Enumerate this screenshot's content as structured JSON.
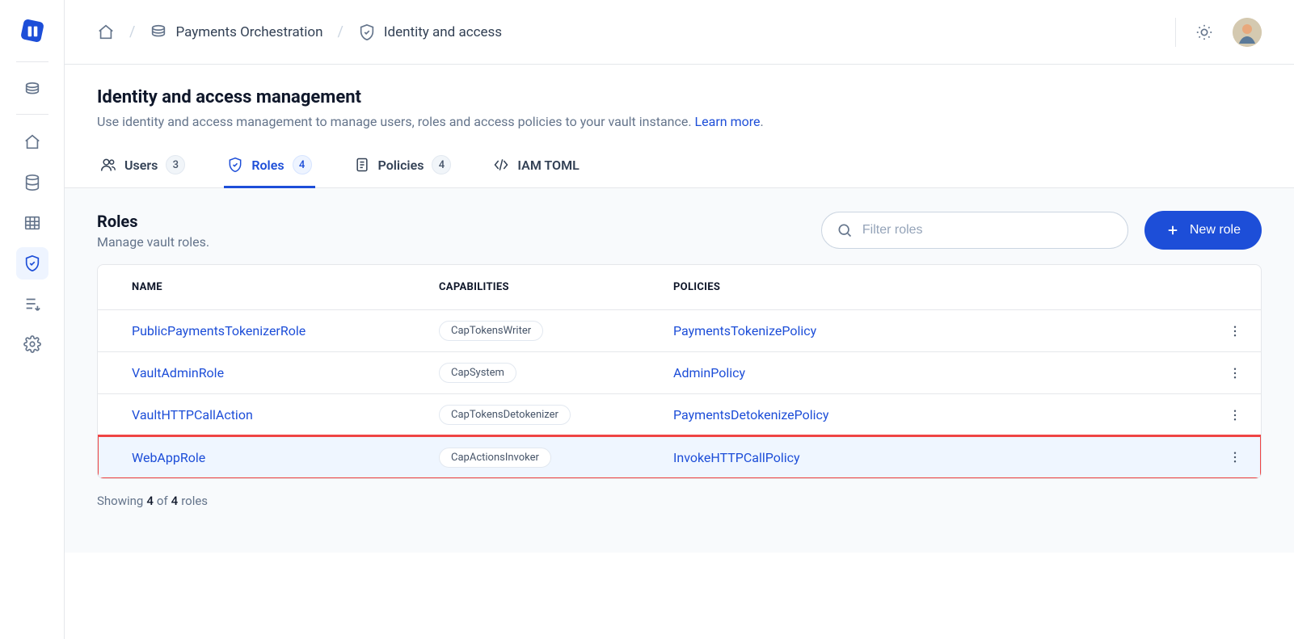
{
  "breadcrumbs": {
    "project": "Payments Orchestration",
    "page": "Identity and access"
  },
  "header": {
    "title": "Identity and access management",
    "desc": "Use identity and access management to manage users, roles and access policies to your vault instance. ",
    "learn_more": "Learn more"
  },
  "tabs": {
    "users": {
      "label": "Users",
      "count": "3"
    },
    "roles": {
      "label": "Roles",
      "count": "4"
    },
    "policies": {
      "label": "Policies",
      "count": "4"
    },
    "iam_toml": {
      "label": "IAM TOML"
    }
  },
  "panel": {
    "title": "Roles",
    "subtitle": "Manage vault roles.",
    "search_placeholder": "Filter roles",
    "new_button": "New role"
  },
  "table": {
    "columns": {
      "name": "NAME",
      "capabilities": "CAPABILITIES",
      "policies": "POLICIES"
    },
    "rows": [
      {
        "name": "PublicPaymentsTokenizerRole",
        "capability": "CapTokensWriter",
        "policy": "PaymentsTokenizePolicy",
        "highlight": false
      },
      {
        "name": "VaultAdminRole",
        "capability": "CapSystem",
        "policy": "AdminPolicy",
        "highlight": false
      },
      {
        "name": "VaultHTTPCallAction",
        "capability": "CapTokensDetokenizer",
        "policy": "PaymentsDetokenizePolicy",
        "highlight": false
      },
      {
        "name": "WebAppRole",
        "capability": "CapActionsInvoker",
        "policy": "InvokeHTTPCallPolicy",
        "highlight": true
      }
    ]
  },
  "footer": {
    "prefix": "Showing ",
    "shown": "4",
    "mid": " of ",
    "total": "4",
    "suffix": " roles"
  }
}
